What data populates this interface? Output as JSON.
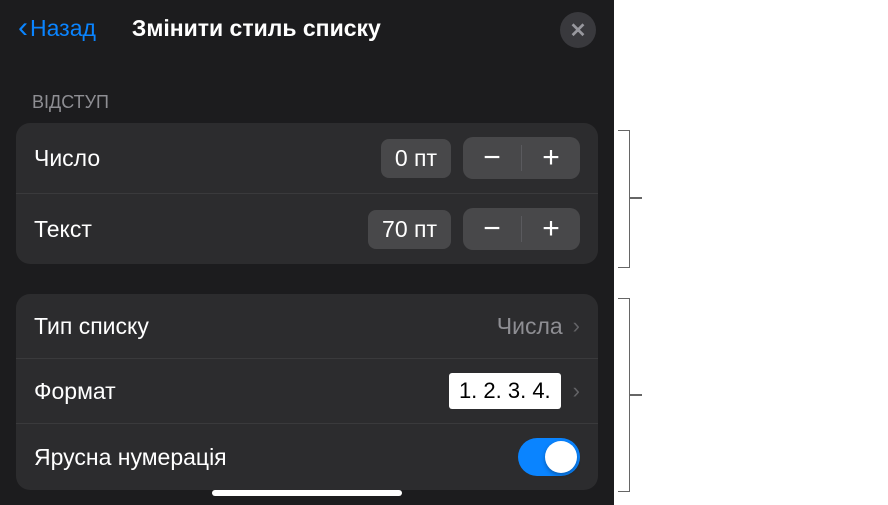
{
  "header": {
    "back_label": "Назад",
    "title": "Змінити стиль списку"
  },
  "indent": {
    "section_label": "ВІДСТУП",
    "number": {
      "label": "Число",
      "value": "0 пт"
    },
    "text": {
      "label": "Текст",
      "value": "70 пт"
    }
  },
  "list": {
    "type": {
      "label": "Тип списку",
      "value": "Числа"
    },
    "format": {
      "label": "Формат",
      "value": "1. 2. 3. 4."
    },
    "tiered": {
      "label": "Ярусна нумерація",
      "enabled": true
    }
  }
}
